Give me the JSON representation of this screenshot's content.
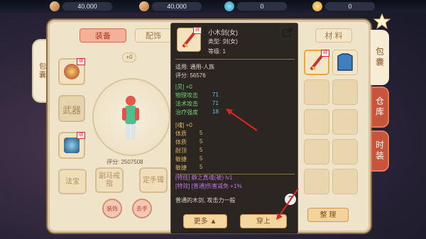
{
  "currency": [
    {
      "icon": "brush-icon",
      "value": "40.000",
      "color": "#e7b77a"
    },
    {
      "icon": "brush-icon",
      "value": "40.000",
      "color": "#e7b77a"
    },
    {
      "icon": "jade-icon",
      "value": "0",
      "color": "#5fc0d8"
    },
    {
      "icon": "gold-coin-icon",
      "value": "0",
      "color": "#f2c14d"
    }
  ],
  "inventory": {
    "side_tab_label": "包囊",
    "tabs": {
      "equip": "装备",
      "accessory": "配饰",
      "material": "材 料"
    },
    "plus0": "+0",
    "weapon_slot_label": "武器",
    "score_label": "评分: 2507508",
    "buttons": {
      "faqi": "法宝",
      "fuma_jie": "副马戒指",
      "dingjie_shouzhuo": "定手镯",
      "round1": "装饰",
      "round2": "去手"
    },
    "tidy_button": "整 理"
  },
  "side_tabs": [
    "包囊",
    "仓库",
    "时装"
  ],
  "tooltip": {
    "badge": "绑",
    "name": "小木剑(女)",
    "type": "类型: 剑(女)",
    "level": "等级: 1",
    "applies": "适用: 通用-人族",
    "score": "评分: 56576",
    "spirit_header": "[灵] +0",
    "spirit_stats": [
      {
        "name": "物理攻击",
        "value": "71"
      },
      {
        "name": "法术攻击",
        "value": "71"
      },
      {
        "name": "治疗强度",
        "value": "18"
      }
    ],
    "soul_header": "[魂] +0",
    "soul_stats": [
      {
        "name": "体质",
        "value": "5"
      },
      {
        "name": "体质",
        "value": "5"
      },
      {
        "name": "耐顶",
        "value": "5"
      },
      {
        "name": "敏捷",
        "value": "5"
      },
      {
        "name": "敏捷",
        "value": "5"
      }
    ],
    "skill_line": "[特技] 静之真魂(被) lv1",
    "effect_line": "[特效] [普通]伤害减免 +1%",
    "desc": "普通的木剑, 攻击力一般",
    "question": "?",
    "more_button": "更多",
    "equip_button": "穿上"
  }
}
